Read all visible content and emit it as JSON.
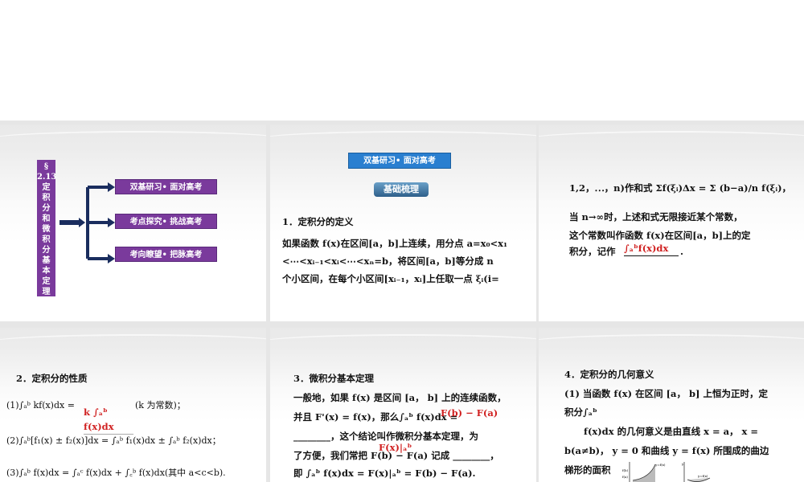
{
  "slide1": {
    "title_chars": [
      "§",
      "2.13",
      "定",
      "积",
      "分",
      "和",
      "微",
      "积",
      "分",
      "基",
      "本",
      "定",
      "理"
    ],
    "menu": [
      "双基研习• 面对高考",
      "考点探究• 挑战高考",
      "考向瞭望• 把脉高考"
    ]
  },
  "slide2": {
    "header": "双基研习• 面对高考",
    "section": "基础梳理",
    "heading": "1．定积分的定义",
    "lines": [
      "如果函数 f(x)在区间[a，b]上连续，用分点 a=x₀<x₁",
      "<⋯<xᵢ₋₁<xᵢ<⋯<xₙ=b，将区间[a，b]等分成 n",
      "个小区间，在每个小区间[xᵢ₋₁，xᵢ]上任取一点 ξᵢ(i="
    ]
  },
  "slide3": {
    "lines": [
      "1,2，⋯，n)作和式 Σf(ξᵢ)Δx = Σ (b−a)/n f(ξᵢ)，",
      "当 n→∞时，上述和式无限接近某个常数，",
      "这个常数叫作函数 f(x)在区间[a，b]上的定",
      "积分，记作"
    ],
    "answer": "∫ₐᵇf(x)dx",
    "end": "."
  },
  "slide4": {
    "heading": "2．定积分的性质",
    "lines": [
      "(1)∫ₐᵇ kf(x)dx =",
      "(k 为常数)；",
      "(2)∫ₐᵇ[f₁(x) ± f₂(x)]dx = ∫ₐᵇ f₁(x)dx ± ∫ₐᵇ f₂(x)dx；",
      "(3)∫ₐᵇ f(x)dx = ∫ₐᶜ f(x)dx + ∫꜀ᵇ f(x)dx(其中 a<c<b)."
    ],
    "answer": "k ∫ₐᵇ f(x)dx"
  },
  "slide5": {
    "heading": "3．微积分基本定理",
    "lines": [
      "一般地，如果 f(x) 是区间 [a， b] 上的连续函数，",
      "并且 F'(x) = f(x)，那么∫ₐᵇ f(x)dx =",
      "________，这个结论叫作微积分基本定理，为",
      "了方便，我们常把 F(b) − F(a) 记成 ________，",
      "即 ∫ₐᵇ f(x)dx = F(x)|ₐᵇ = F(b) − F(a)."
    ],
    "answer1": "F(b) − F(a)",
    "answer2": "F(x)|ₐᵇ"
  },
  "slide6": {
    "heading": "4．定积分的几何意义",
    "lines": [
      "(1) 当函数 f(x) 在区间 [a， b] 上恒为正时，定",
      "积分∫ₐᵇ",
      "f(x)dx 的几何意义是由直线 x = a， x =",
      "b(a≠b)， y = 0 和曲线 y = f(x) 所围成的曲边",
      "梯形的面积"
    ],
    "graph_labels": [
      "y=f(x)",
      "f(b)",
      "f(a)",
      "y",
      "y=f(x)"
    ]
  }
}
